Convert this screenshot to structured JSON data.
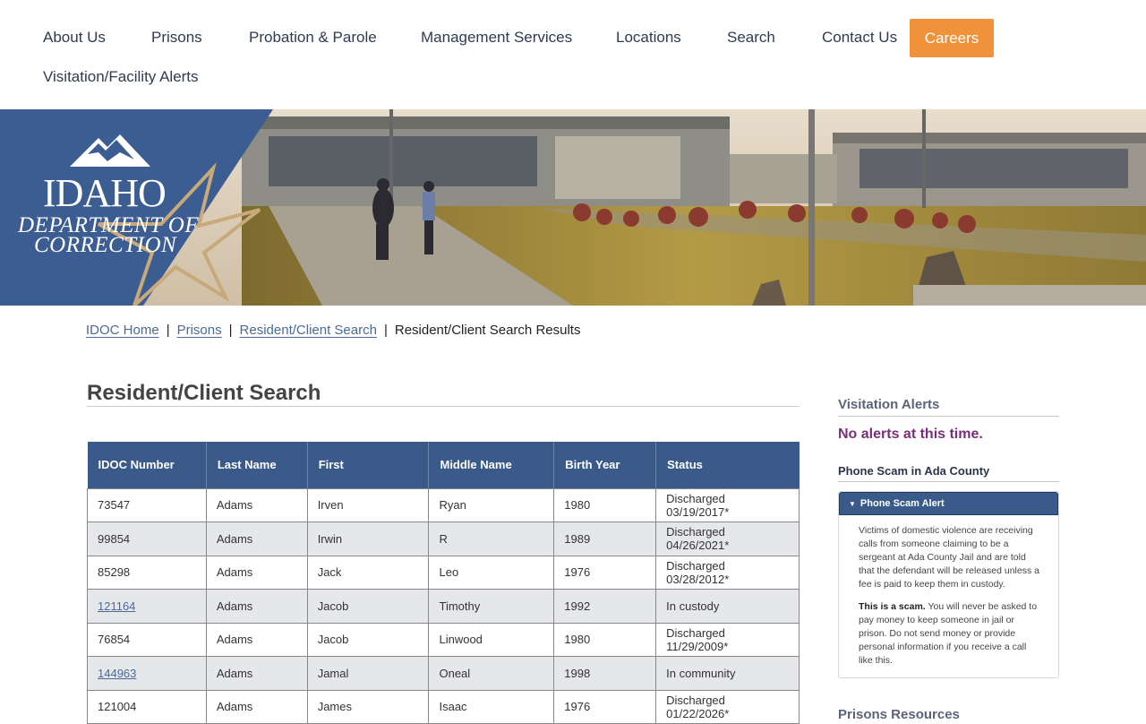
{
  "nav": {
    "items": [
      {
        "label": "About Us"
      },
      {
        "label": "Prisons"
      },
      {
        "label": "Probation & Parole"
      },
      {
        "label": "Management Services"
      },
      {
        "label": "Locations"
      },
      {
        "label": "Search"
      },
      {
        "label": "Contact Us"
      }
    ],
    "careers_label": "Careers",
    "alerts_label": "Visitation/Facility Alerts"
  },
  "logo": {
    "line1": "IDAHO",
    "line2": "DEPARTMENT OF",
    "line3": "CORRECTION"
  },
  "breadcrumb": {
    "items": [
      "IDOC Home",
      "Prisons",
      "Resident/Client Search"
    ],
    "current": "Resident/Client Search Results",
    "separator": "|"
  },
  "main": {
    "title": "Resident/Client Search",
    "table": {
      "headers": [
        "IDOC Number",
        "Last Name",
        "First",
        "Middle Name",
        "Birth Year",
        "Status"
      ],
      "rows": [
        [
          "73547",
          "Adams",
          "Irven",
          "Ryan",
          "1980",
          "Discharged 03/19/2017*"
        ],
        [
          "99854",
          "Adams",
          "Irwin",
          "R",
          "1989",
          "Discharged 04/26/2021*"
        ],
        [
          "85298",
          "Adams",
          "Jack",
          "Leo",
          "1976",
          "Discharged 03/28/2012*"
        ],
        [
          "121164",
          "Adams",
          "Jacob",
          "Timothy",
          "1992",
          "In custody"
        ],
        [
          "76854",
          "Adams",
          "Jacob",
          "Linwood",
          "1980",
          "Discharged 11/29/2009*"
        ],
        [
          "144963",
          "Adams",
          "Jamal",
          "Oneal",
          "1998",
          "In community"
        ],
        [
          "121004",
          "Adams",
          "James",
          "Isaac",
          "1976",
          "Discharged 01/22/2026*"
        ]
      ],
      "linked_rows": [
        3,
        5
      ]
    }
  },
  "sidebar": {
    "visitation_heading": "Visitation Alerts",
    "no_alerts": "No alerts at this time.",
    "scam_heading": "Phone Scam in Ada County",
    "scam_accordion_title": "Phone Scam Alert",
    "scam_para1": "Victims of domestic violence are receiving calls from someone claiming to be a sergeant at Ada County Jail and are told that the defendant will be released unless a fee is paid to keep them in custody.",
    "scam_bold": "This is a scam.",
    "scam_para2": " You will never be asked to pay money to keep someone in jail or prison. Do not send money or provide personal information if you receive a call like this.",
    "resources_heading": "Prisons Resources"
  },
  "colors": {
    "nav_text": "#2f3b52",
    "careers_bg": "#f0923a",
    "header_blue": "#3a5a8a",
    "link": "#4a6a97",
    "alert_purple": "#7a2e7a"
  }
}
